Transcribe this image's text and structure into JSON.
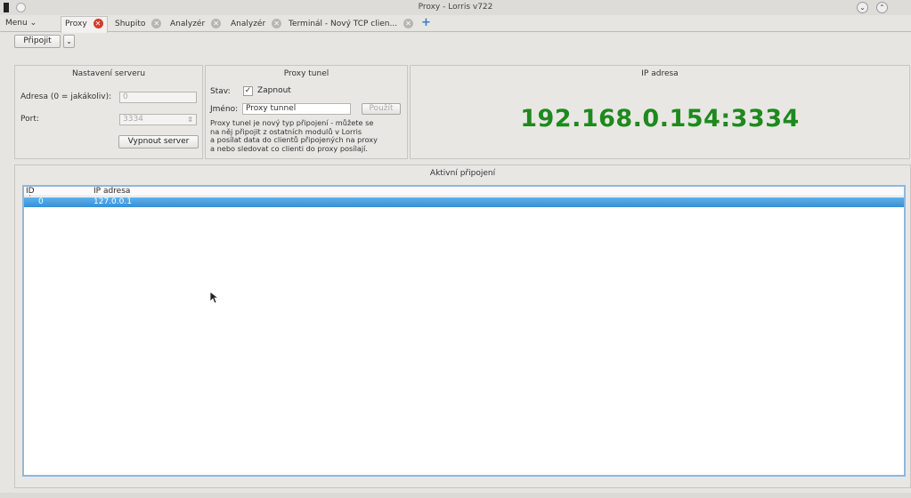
{
  "window": {
    "title": "Proxy - Lorris v722",
    "min_icon": "chevron-down-icon",
    "max_icon": "chevron-up-icon",
    "close_icon": "close-icon"
  },
  "menu": {
    "label": "Menu ⌄"
  },
  "tabs": [
    {
      "label": "Proxy",
      "active": true
    },
    {
      "label": "Shupito"
    },
    {
      "label": "Analyzér"
    },
    {
      "label": "Analyzér"
    },
    {
      "label": "Terminál - Nový TCP clien..."
    }
  ],
  "tab_close_glyph": "✕",
  "add_tab_glyph": "+",
  "toolbar": {
    "connect_label": "Připojit",
    "dropdown_glyph": "⌄"
  },
  "server": {
    "heading": "Nastavení serveru",
    "address_label": "Adresa (0 = jakákoliv):",
    "address_value": "0",
    "port_label": "Port:",
    "port_value": "3334",
    "stop_button": "Vypnout server"
  },
  "tunnel": {
    "heading": "Proxy tunel",
    "state_label": "Stav:",
    "enable_label": "Zapnout",
    "enable_checked": true,
    "check_glyph": "✓",
    "name_label": "Jméno:",
    "name_value": "Proxy tunnel",
    "apply_button": "Použít",
    "description": [
      "Proxy tunel je nový typ připojení - můžete se",
      "na něj připojit z ostatních modulů v Lorris",
      "a posílat data do clientů připojených na proxy",
      "a nebo sledovat co clienti do proxy posílají."
    ]
  },
  "ip": {
    "heading": "IP adresa",
    "value": "192.168.0.154:3334",
    "color": "#1d8a1d"
  },
  "connections": {
    "heading": "Aktivní připojení",
    "columns": [
      "ID",
      "IP adresa"
    ],
    "rows": [
      {
        "id": "0",
        "ip": "127.0.0.1"
      }
    ],
    "selection_color": "#3590d9"
  }
}
